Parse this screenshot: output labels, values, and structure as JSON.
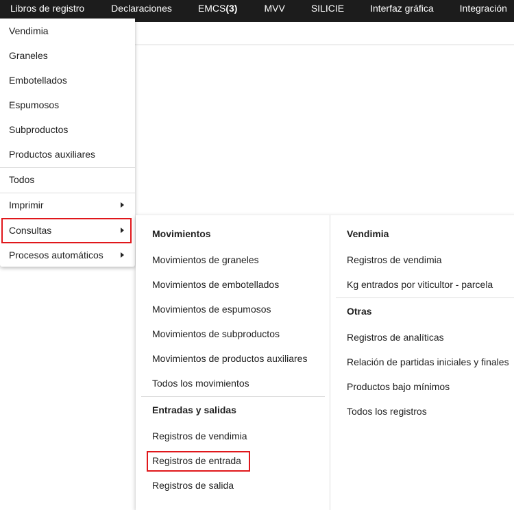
{
  "topnav": {
    "items": [
      {
        "label": "Libros de registro"
      },
      {
        "label": "Declaraciones"
      },
      {
        "label": "EMCS",
        "badge": "(3)"
      },
      {
        "label": "MVV"
      },
      {
        "label": "SILICIE"
      },
      {
        "label": "Interfaz gráfica"
      },
      {
        "label": "Integración"
      }
    ]
  },
  "menu": {
    "items": [
      {
        "label": "Vendimia"
      },
      {
        "label": "Graneles"
      },
      {
        "label": "Embotellados"
      },
      {
        "label": "Espumosos"
      },
      {
        "label": "Subproductos"
      },
      {
        "label": "Productos auxiliares"
      },
      {
        "label": "Todos"
      },
      {
        "label": "Imprimir"
      },
      {
        "label": "Consultas"
      },
      {
        "label": "Procesos automáticos"
      }
    ]
  },
  "submenu": {
    "col1": {
      "movimientos_header": "Movimientos",
      "movimientos": [
        "Movimientos de graneles",
        "Movimientos de embotellados",
        "Movimientos de espumosos",
        "Movimientos de subproductos",
        "Movimientos de productos auxiliares",
        "Todos los movimientos"
      ],
      "entradas_header": "Entradas y salidas",
      "entradas": [
        "Registros de vendimia",
        "Registros de entrada",
        "Registros de salida"
      ]
    },
    "col2": {
      "vendimia_header": "Vendimia",
      "vendimia": [
        "Registros de vendimia",
        "Kg entrados por viticultor - parcela"
      ],
      "otras_header": "Otras",
      "otras": [
        "Registros de analíticas",
        "Relación de partidas iniciales y finales",
        "Productos bajo mínimos",
        "Todos los registros"
      ]
    }
  },
  "colors": {
    "topbar_bg": "#1c1c1c",
    "highlight": "#e0171b"
  }
}
